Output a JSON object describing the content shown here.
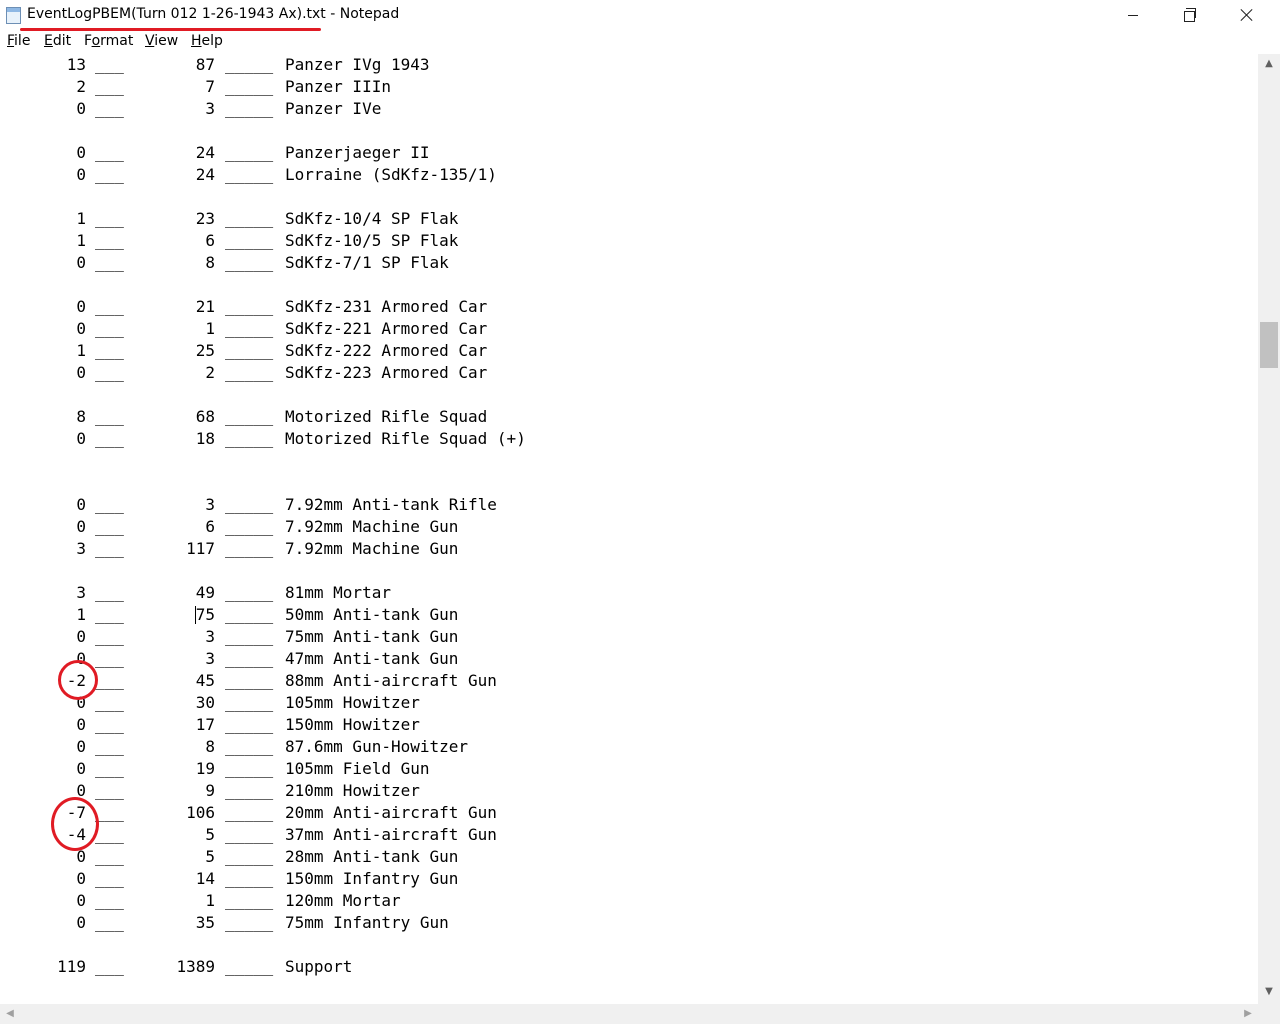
{
  "window": {
    "title": "EventLogPBEM(Turn 012 1-26-1943 Ax).txt - Notepad",
    "icon": "notepad-icon",
    "annotation_color": "#e01b24"
  },
  "menu": [
    {
      "label": "File",
      "underline": "F",
      "rest": "ile"
    },
    {
      "label": "Edit",
      "underline": "E",
      "rest": "dit"
    },
    {
      "label": "Format",
      "pre": "F",
      "underline": "o",
      "rest": "rmat"
    },
    {
      "label": "View",
      "underline": "V",
      "rest": "iew"
    },
    {
      "label": "Help",
      "underline": "H",
      "rest": "elp"
    }
  ],
  "blank": "___",
  "blank_long": "_____",
  "rows": [
    {
      "a": "13",
      "b": "87",
      "name": "Panzer IVg 1943"
    },
    {
      "a": "2",
      "b": "7",
      "name": "Panzer IIIn"
    },
    {
      "a": "0",
      "b": "3",
      "name": "Panzer IVe"
    },
    null,
    {
      "a": "0",
      "b": "24",
      "name": "Panzerjaeger II"
    },
    {
      "a": "0",
      "b": "24",
      "name": "Lorraine (SdKfz-135/1)"
    },
    null,
    {
      "a": "1",
      "b": "23",
      "name": "SdKfz-10/4 SP Flak"
    },
    {
      "a": "1",
      "b": "6",
      "name": "SdKfz-10/5 SP Flak"
    },
    {
      "a": "0",
      "b": "8",
      "name": "SdKfz-7/1 SP Flak"
    },
    null,
    {
      "a": "0",
      "b": "21",
      "name": "SdKfz-231 Armored Car"
    },
    {
      "a": "0",
      "b": "1",
      "name": "SdKfz-221 Armored Car"
    },
    {
      "a": "1",
      "b": "25",
      "name": "SdKfz-222 Armored Car"
    },
    {
      "a": "0",
      "b": "2",
      "name": "SdKfz-223 Armored Car"
    },
    null,
    {
      "a": "8",
      "b": "68",
      "name": "Motorized Rifle Squad"
    },
    {
      "a": "0",
      "b": "18",
      "name": "Motorized Rifle Squad (+)"
    },
    null,
    null,
    {
      "a": "0",
      "b": "3",
      "name": "7.92mm Anti-tank Rifle"
    },
    {
      "a": "0",
      "b": "6",
      "name": "7.92mm Machine Gun"
    },
    {
      "a": "3",
      "b": "117",
      "name": "7.92mm Machine Gun"
    },
    null,
    {
      "a": "3",
      "b": "49",
      "name": "81mm Mortar"
    },
    {
      "a": "1",
      "b": "75",
      "name": "50mm Anti-tank Gun"
    },
    {
      "a": "0",
      "b": "3",
      "name": "75mm Anti-tank Gun"
    },
    {
      "a": "0",
      "b": "3",
      "name": "47mm Anti-tank Gun"
    },
    {
      "a": "-2",
      "b": "45",
      "name": "88mm Anti-aircraft Gun"
    },
    {
      "a": "0",
      "b": "30",
      "name": "105mm Howitzer"
    },
    {
      "a": "0",
      "b": "17",
      "name": "150mm Howitzer"
    },
    {
      "a": "0",
      "b": "8",
      "name": "87.6mm Gun-Howitzer"
    },
    {
      "a": "0",
      "b": "19",
      "name": "105mm Field Gun"
    },
    {
      "a": "0",
      "b": "9",
      "name": "210mm Howitzer"
    },
    {
      "a": "-7",
      "b": "106",
      "name": "20mm Anti-aircraft Gun"
    },
    {
      "a": "-4",
      "b": "5",
      "name": "37mm Anti-aircraft Gun"
    },
    {
      "a": "0",
      "b": "5",
      "name": "28mm Anti-tank Gun"
    },
    {
      "a": "0",
      "b": "14",
      "name": "150mm Infantry Gun"
    },
    {
      "a": "0",
      "b": "1",
      "name": "120mm Mortar"
    },
    {
      "a": "0",
      "b": "35",
      "name": "75mm Infantry Gun"
    },
    null,
    {
      "a": "119",
      "b": "1389",
      "name": "Support"
    }
  ]
}
